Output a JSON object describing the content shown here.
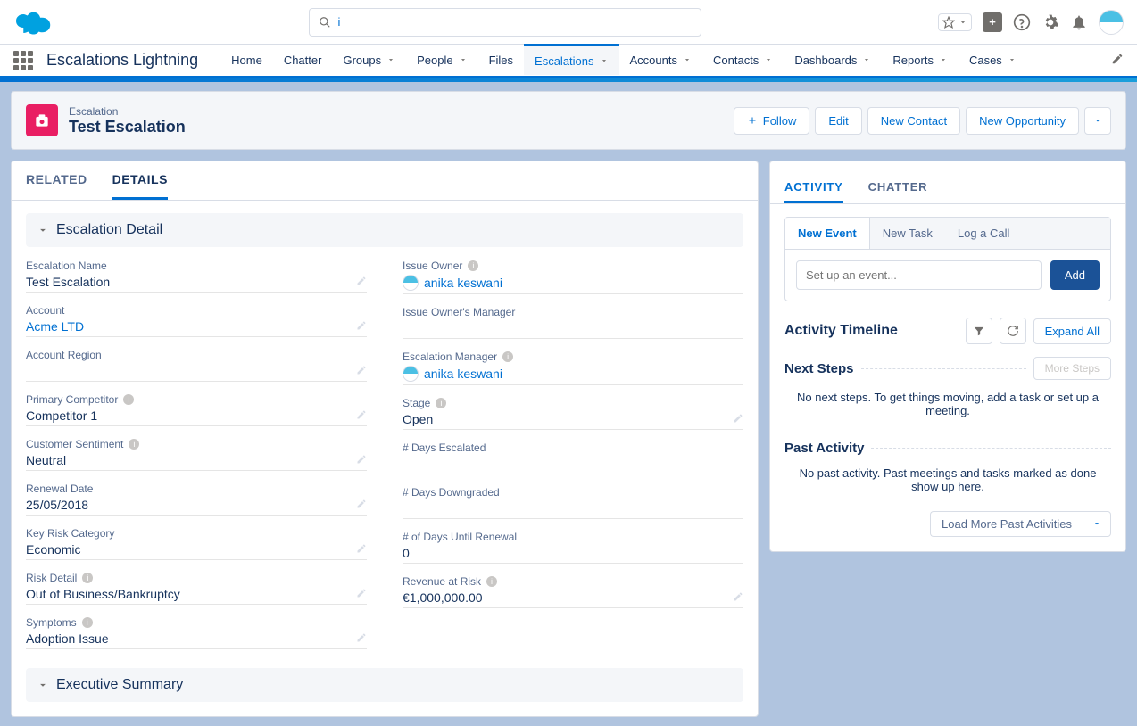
{
  "search": {
    "value": "i"
  },
  "appName": "Escalations Lightning",
  "nav": [
    {
      "label": "Home",
      "chev": false
    },
    {
      "label": "Chatter",
      "chev": false
    },
    {
      "label": "Groups",
      "chev": true
    },
    {
      "label": "People",
      "chev": true
    },
    {
      "label": "Files",
      "chev": false
    },
    {
      "label": "Escalations",
      "chev": true,
      "active": true
    },
    {
      "label": "Accounts",
      "chev": true
    },
    {
      "label": "Contacts",
      "chev": true
    },
    {
      "label": "Dashboards",
      "chev": true
    },
    {
      "label": "Reports",
      "chev": true
    },
    {
      "label": "Cases",
      "chev": true
    }
  ],
  "record": {
    "object": "Escalation",
    "title": "Test Escalation",
    "actions": {
      "follow": "Follow",
      "edit": "Edit",
      "newContact": "New Contact",
      "newOpportunity": "New Opportunity"
    }
  },
  "mainTabs": {
    "related": "RELATED",
    "details": "DETAILS"
  },
  "sections": {
    "escalationDetail": "Escalation Detail",
    "executiveSummary": "Executive Summary"
  },
  "fields": {
    "left": {
      "escalationName": {
        "label": "Escalation Name",
        "value": "Test Escalation"
      },
      "account": {
        "label": "Account",
        "value": "Acme LTD"
      },
      "accountRegion": {
        "label": "Account Region",
        "value": ""
      },
      "primaryCompetitor": {
        "label": "Primary Competitor",
        "value": "Competitor 1",
        "info": true
      },
      "customerSentiment": {
        "label": "Customer Sentiment",
        "value": "Neutral",
        "info": true
      },
      "renewalDate": {
        "label": "Renewal Date",
        "value": "25/05/2018"
      },
      "keyRiskCategory": {
        "label": "Key Risk Category",
        "value": "Economic"
      },
      "riskDetail": {
        "label": "Risk Detail",
        "value": "Out of Business/Bankruptcy",
        "info": true
      },
      "symptoms": {
        "label": "Symptoms",
        "value": "Adoption Issue",
        "info": true
      }
    },
    "right": {
      "issueOwner": {
        "label": "Issue Owner",
        "value": "anika keswani",
        "info": true,
        "user": true
      },
      "issueOwnersManager": {
        "label": "Issue Owner's Manager",
        "value": ""
      },
      "escalationManager": {
        "label": "Escalation Manager",
        "value": "anika keswani",
        "info": true,
        "user": true
      },
      "stage": {
        "label": "Stage",
        "value": "Open",
        "info": true
      },
      "daysEscalated": {
        "label": "# Days Escalated",
        "value": ""
      },
      "daysDowngraded": {
        "label": "# Days Downgraded",
        "value": ""
      },
      "daysUntilRenewal": {
        "label": "# of Days Until Renewal",
        "value": "0"
      },
      "revenueAtRisk": {
        "label": "Revenue at Risk",
        "value": "€1,000,000.00",
        "info": true
      }
    }
  },
  "side": {
    "tabs": {
      "activity": "ACTIVITY",
      "chatter": "CHATTER"
    },
    "composer": {
      "newEvent": "New Event",
      "newTask": "New Task",
      "logCall": "Log a Call",
      "placeholder": "Set up an event...",
      "add": "Add"
    },
    "timeline": {
      "title": "Activity Timeline",
      "expandAll": "Expand All",
      "nextSteps": "Next Steps",
      "moreSteps": "More Steps",
      "nextMsg": "No next steps. To get things moving, add a task or set up a meeting.",
      "pastActivity": "Past Activity",
      "pastMsg": "No past activity. Past meetings and tasks marked as done show up here.",
      "loadMore": "Load More Past Activities"
    }
  }
}
